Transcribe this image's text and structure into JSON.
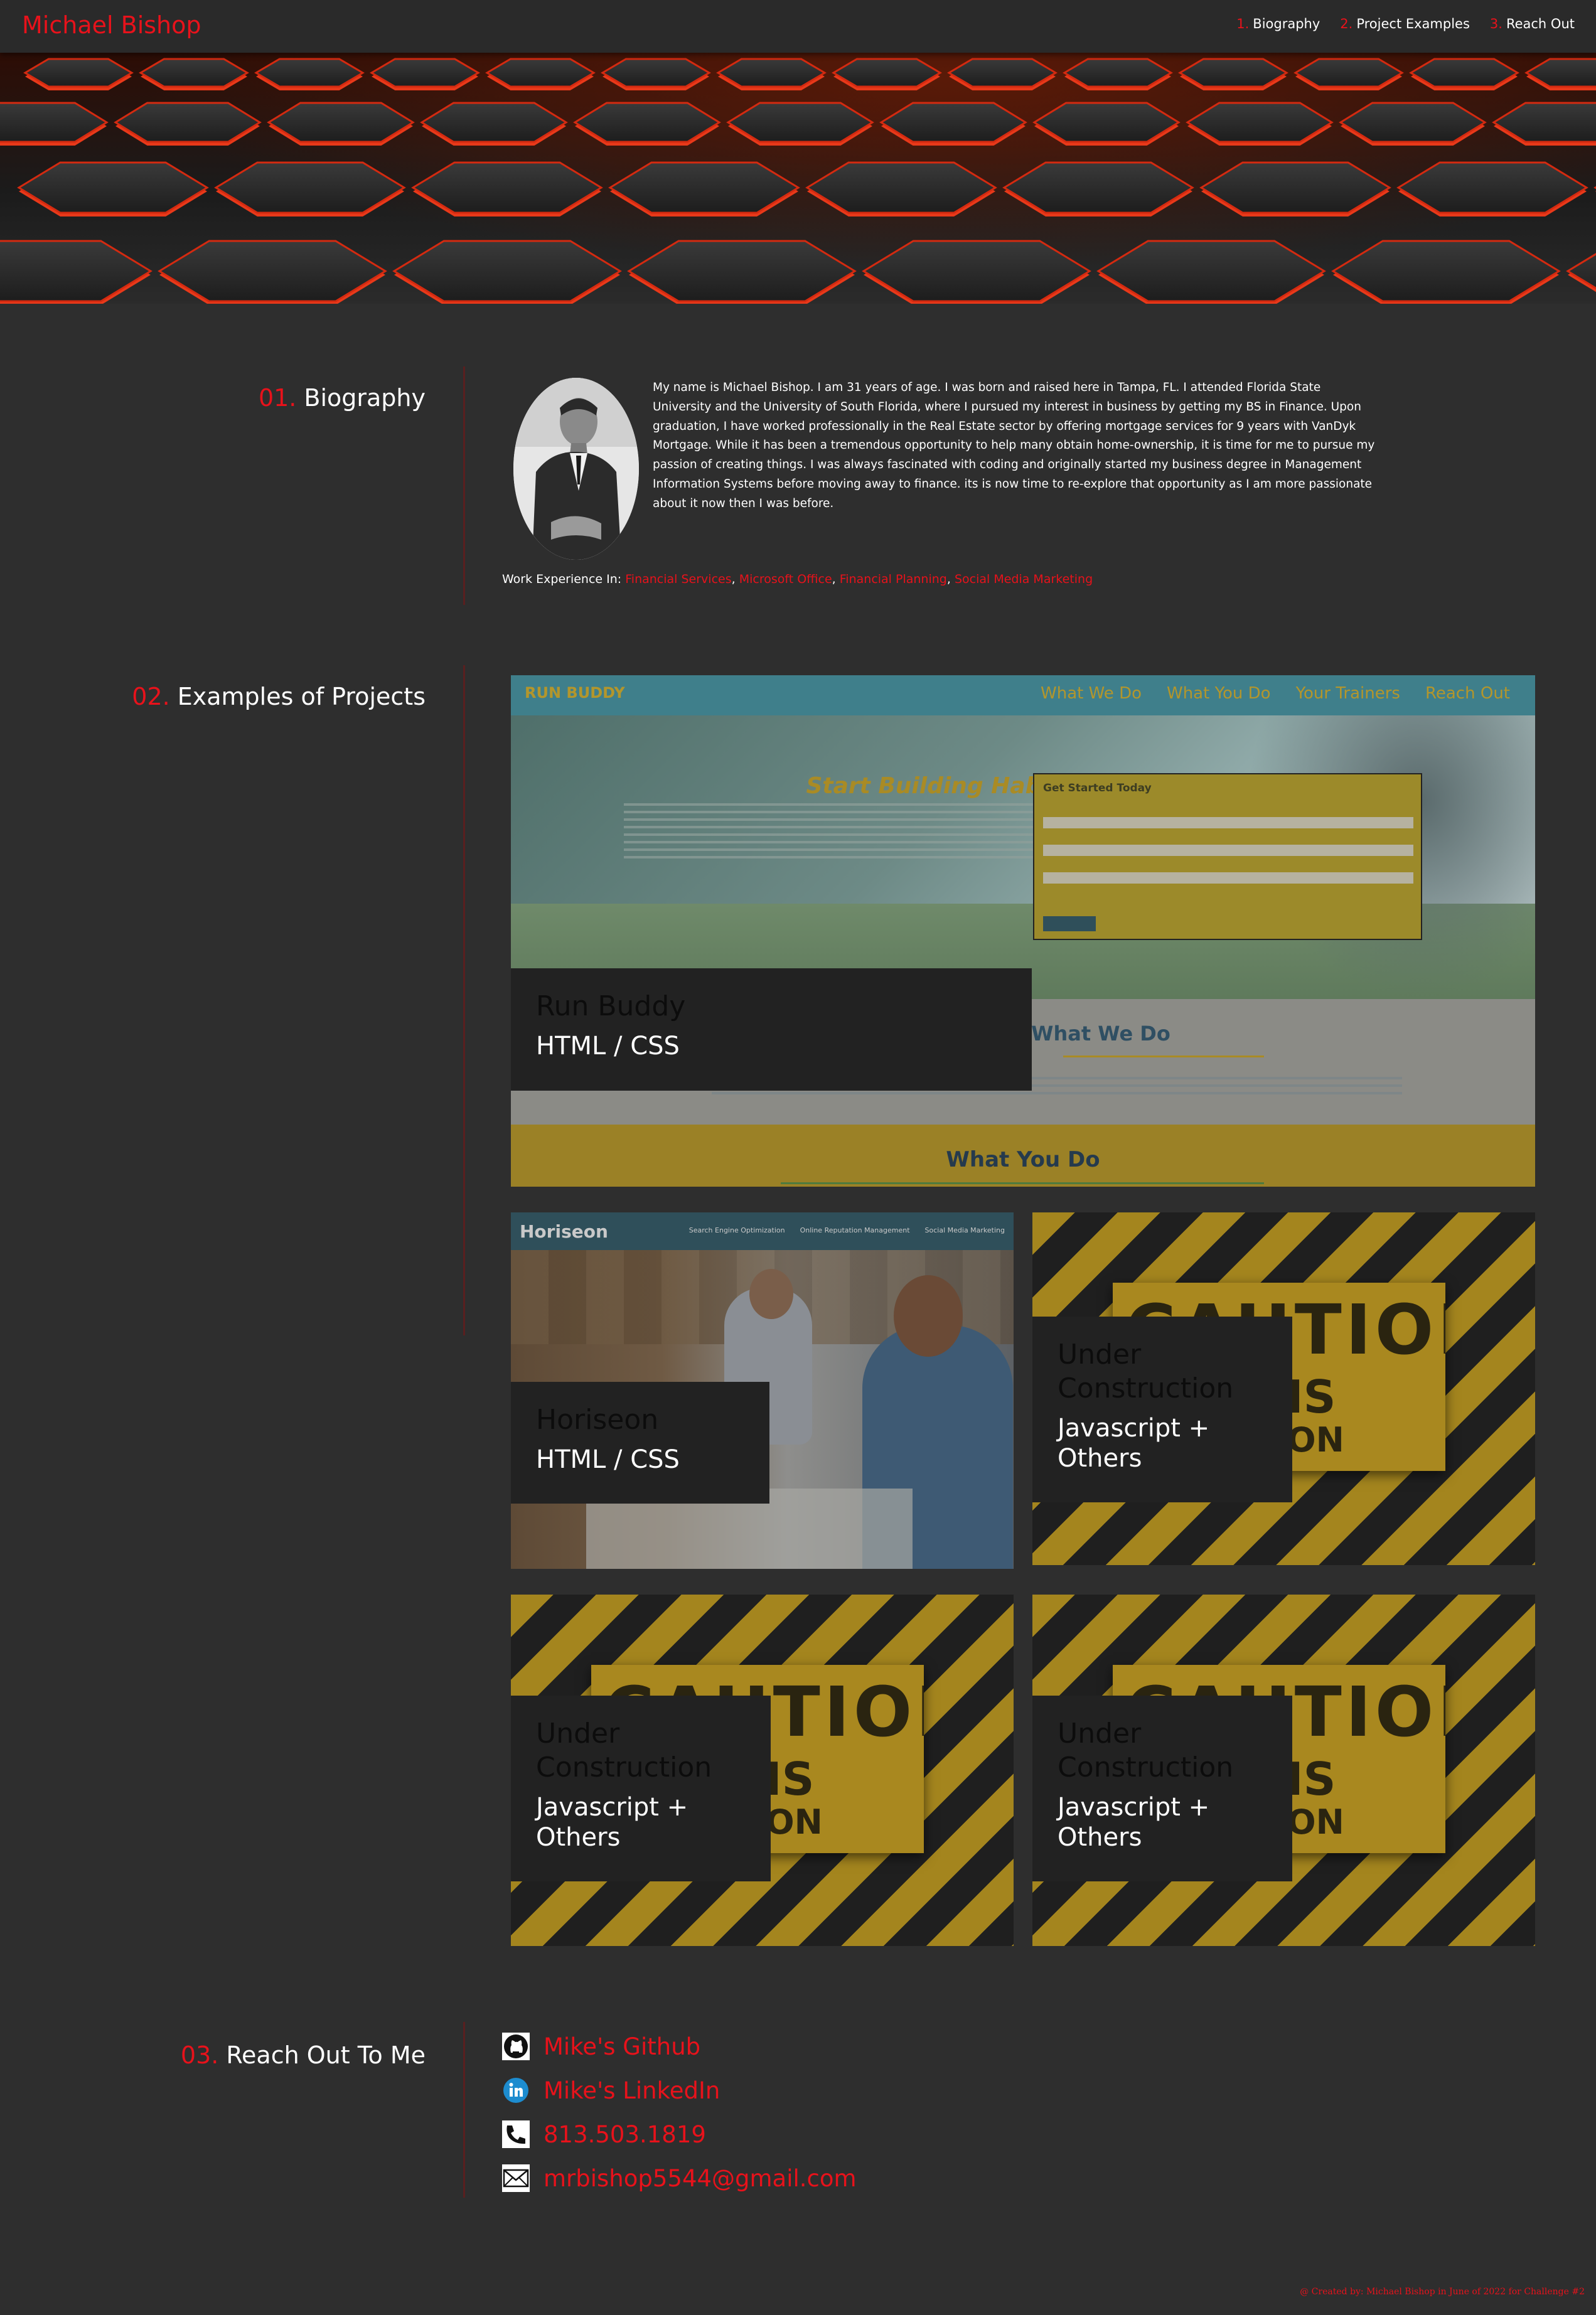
{
  "header": {
    "brand": "Michael Bishop",
    "nav": [
      {
        "num": "1.",
        "label": "Biography"
      },
      {
        "num": "2.",
        "label": "Project Examples"
      },
      {
        "num": "3.",
        "label": "Reach Out"
      }
    ]
  },
  "biography": {
    "num": "01.",
    "title": "Biography",
    "text": "My name is Michael Bishop. I am 31 years of age. I was born and raised here in Tampa, FL. I attended Florida State University and the University of South Florida, where I pursued my interest in business by getting my BS in Finance. Upon graduation, I have worked professionally in the Real Estate sector by offering mortgage services for 9 years with VanDyk Mortgage. While it has been a tremendous opportunity to help many obtain home-ownership, it is time for me to pursue my passion of creating things. I was always fascinated with coding and originally started my business degree in Management Information Systems before moving away to finance. its is now time to re-explore that opportunity as I am more passionate about it now then I was before.",
    "work_label": "Work Experience In:",
    "work_items": [
      "Financial Services",
      "Microsoft Office",
      "Financial Planning",
      "Social Media Marketing"
    ]
  },
  "projects": {
    "num": "02.",
    "title": "Examples of Projects",
    "cards": [
      {
        "name": "Run Buddy",
        "tech": "HTML / CSS"
      },
      {
        "name": "Horiseon",
        "tech": "HTML / CSS"
      },
      {
        "name": "Under Construction",
        "tech": "Javascript + Others"
      },
      {
        "name": "Under Construction",
        "tech": "Javascript + Others"
      },
      {
        "name": "Under Construction",
        "tech": "Javascript + Others"
      }
    ],
    "runbuddy": {
      "logo": "RUN BUDDY",
      "nav": [
        "What We Do",
        "What You Do",
        "Your Trainers",
        "Reach Out"
      ],
      "headline": "Start Building Habits.",
      "form_title": "Get Started Today",
      "section1": "What We Do",
      "section2": "What You Do"
    },
    "horiseon": {
      "logo": "Horiseon",
      "nav": [
        "Search Engine Optimization",
        "Online Reputation Management",
        "Social Media Marketing"
      ]
    },
    "caution": {
      "line1": "CAUTION",
      "line2": "BSITE IS",
      "line3": "STRUCTION"
    }
  },
  "contact": {
    "num": "03.",
    "title": "Reach Out To Me",
    "links": [
      {
        "icon": "github-icon",
        "label": "Mike's Github"
      },
      {
        "icon": "linkedin-icon",
        "label": "Mike's LinkedIn"
      },
      {
        "icon": "phone-icon",
        "label": "813.503.1819"
      },
      {
        "icon": "email-icon",
        "label": "mrbishop5544@gmail.com"
      }
    ]
  },
  "footer": "@ Created by: Michael Bishop in June of 2022 for Challenge #2"
}
